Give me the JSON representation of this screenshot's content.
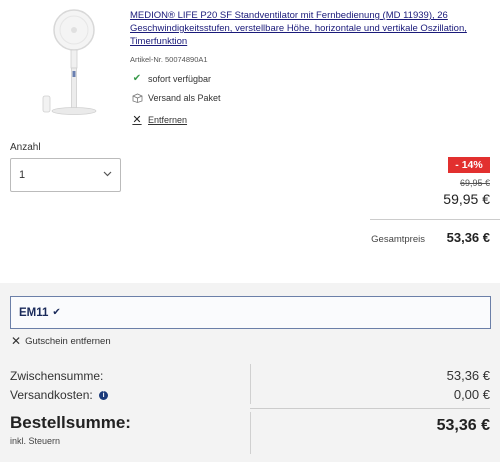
{
  "product": {
    "title": "MEDION® LIFE P20 SF Standventilator mit Fernbedienung (MD 11939), 26 Geschwindigkeitsstufen, verstellbare Höhe, horizontale und vertikale Oszillation, Timerfunktion",
    "article_number": "Artikel-Nr. 50074890A1",
    "availability": "sofort verfügbar",
    "shipping": "Versand als Paket",
    "remove_label": "Entfernen",
    "icons": {
      "availability": "check-icon",
      "shipping": "package-icon",
      "remove": "close-icon"
    }
  },
  "quantity": {
    "label": "Anzahl",
    "value": "1"
  },
  "price": {
    "discount": "- 14%",
    "old": "69,95 €",
    "new": "59,95 €",
    "total_label": "Gesamtpreis",
    "total_value": "53,36 €"
  },
  "coupon": {
    "code": "EM11",
    "remove_label": "Gutschein entfernen"
  },
  "summary": {
    "subtotal_label": "Zwischensumme:",
    "subtotal_value": "53,36 €",
    "shipping_label": "Versandkosten:",
    "shipping_value": "0,00 €",
    "grand_label": "Bestellsumme:",
    "tax_note": "inkl. Steuern",
    "grand_value": "53,36 €"
  },
  "colors": {
    "discount_badge": "#e2302f",
    "link": "#1a1a7a",
    "coupon_border": "#6b7fa8",
    "summary_bg": "#f3f3f3",
    "available": "#3a9b4b"
  }
}
